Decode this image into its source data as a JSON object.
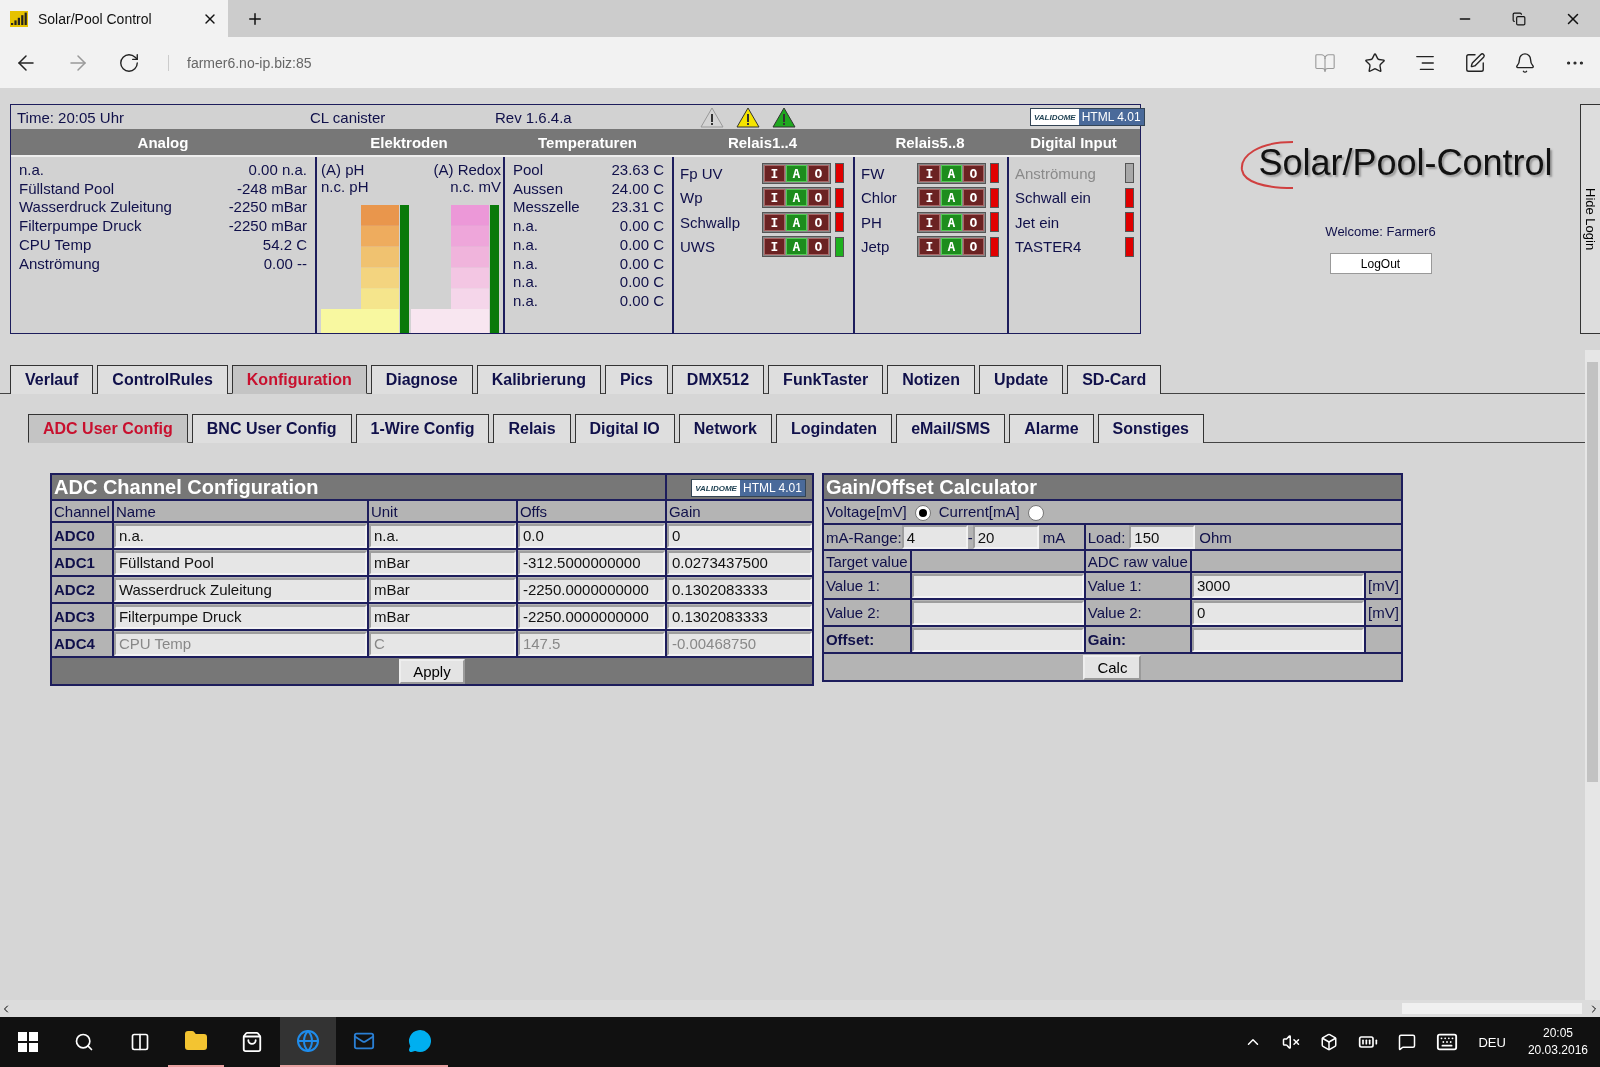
{
  "browser": {
    "tab_title": "Solar/Pool Control",
    "address": "farmer6.no-ip.biz:85"
  },
  "status": {
    "time": "Time: 20:05 Uhr",
    "mode": "CL canister",
    "revision": "Rev 1.6.4.a",
    "warnings": [
      {
        "color": "#d4d4d4"
      },
      {
        "color": "#f5e400"
      },
      {
        "color": "#1fa81f"
      }
    ],
    "badge": {
      "logo": "VALIDOME",
      "label": "HTML 4.01"
    }
  },
  "sections": [
    "Analog",
    "Elektroden",
    "Temperaturen",
    "Relais1..4",
    "Relais5..8",
    "Digital Input"
  ],
  "analog": [
    {
      "name": "n.a.",
      "value": "0.00 n.a."
    },
    {
      "name": "Füllstand Pool",
      "value": "-248 mBar"
    },
    {
      "name": "Wasserdruck Zuleitung",
      "value": "-2250 mBar"
    },
    {
      "name": "Filterpumpe Druck",
      "value": "-2250 mBar"
    },
    {
      "name": "CPU Temp",
      "value": "54.2 C"
    },
    {
      "name": "Anströmung",
      "value": "0.00 --"
    }
  ],
  "electrodes": [
    {
      "kind": "ph",
      "label": "(A) pH",
      "reading": "n.c. pH"
    },
    {
      "kind": "redox",
      "label": "(A) Redox",
      "reading": "n.c. mV"
    }
  ],
  "temperatures": [
    {
      "name": "Pool",
      "value": "23.63 C"
    },
    {
      "name": "Aussen",
      "value": "24.00 C"
    },
    {
      "name": "Messzelle",
      "value": "23.31 C"
    },
    {
      "name": "n.a.",
      "value": "0.00 C"
    },
    {
      "name": "n.a.",
      "value": "0.00 C"
    },
    {
      "name": "n.a.",
      "value": "0.00 C"
    },
    {
      "name": "n.a.",
      "value": "0.00 C"
    },
    {
      "name": "n.a.",
      "value": "0.00 C"
    }
  ],
  "relays_1_4": [
    {
      "name": "Fp UV",
      "on": false,
      "buttons": [
        {
          "label": "I",
          "selected": false
        },
        {
          "label": "A",
          "selected": true
        },
        {
          "label": "O",
          "selected": false
        }
      ]
    },
    {
      "name": "Wp",
      "on": false,
      "buttons": [
        {
          "label": "I",
          "selected": false
        },
        {
          "label": "A",
          "selected": true
        },
        {
          "label": "O",
          "selected": false
        }
      ]
    },
    {
      "name": "Schwallp",
      "on": false,
      "buttons": [
        {
          "label": "I",
          "selected": false
        },
        {
          "label": "A",
          "selected": true
        },
        {
          "label": "O",
          "selected": false
        }
      ]
    },
    {
      "name": "UWS",
      "on": true,
      "buttons": [
        {
          "label": "I",
          "selected": false
        },
        {
          "label": "A",
          "selected": true
        },
        {
          "label": "O",
          "selected": false
        }
      ]
    }
  ],
  "relays_5_8": [
    {
      "name": "FW",
      "on": false,
      "buttons": [
        {
          "label": "I",
          "selected": false
        },
        {
          "label": "A",
          "selected": true
        },
        {
          "label": "O",
          "selected": false
        }
      ]
    },
    {
      "name": "Chlor",
      "on": false,
      "buttons": [
        {
          "label": "I",
          "selected": false
        },
        {
          "label": "A",
          "selected": true
        },
        {
          "label": "O",
          "selected": false
        }
      ]
    },
    {
      "name": "PH",
      "on": false,
      "buttons": [
        {
          "label": "I",
          "selected": false
        },
        {
          "label": "A",
          "selected": true
        },
        {
          "label": "O",
          "selected": false
        }
      ]
    },
    {
      "name": "Jetp",
      "on": false,
      "buttons": [
        {
          "label": "I",
          "selected": false
        },
        {
          "label": "A",
          "selected": true
        },
        {
          "label": "O",
          "selected": false
        }
      ]
    }
  ],
  "digital_inputs": [
    {
      "name": "Anströmung",
      "disabled": true
    },
    {
      "name": "Schwall ein",
      "disabled": false
    },
    {
      "name": "Jet ein",
      "disabled": false
    },
    {
      "name": "TASTER4",
      "disabled": false
    }
  ],
  "login": {
    "logo": "Solar/Pool-Control",
    "welcome": "Welcome: Farmer6",
    "logout": "LogOut",
    "hide": "Hide Login"
  },
  "tabs": [
    {
      "label": "Verlauf",
      "selected": false
    },
    {
      "label": "ControlRules",
      "selected": false
    },
    {
      "label": "Konfiguration",
      "selected": true
    },
    {
      "label": "Diagnose",
      "selected": false
    },
    {
      "label": "Kalibrierung",
      "selected": false
    },
    {
      "label": "Pics",
      "selected": false
    },
    {
      "label": "DMX512",
      "selected": false
    },
    {
      "label": "FunkTaster",
      "selected": false
    },
    {
      "label": "Notizen",
      "selected": false
    },
    {
      "label": "Update",
      "selected": false
    },
    {
      "label": "SD-Card",
      "selected": false
    }
  ],
  "subtabs": [
    {
      "label": "ADC User Config",
      "selected": true
    },
    {
      "label": "BNC User Config",
      "selected": false
    },
    {
      "label": "1-Wire Config",
      "selected": false
    },
    {
      "label": "Relais",
      "selected": false
    },
    {
      "label": "Digital IO",
      "selected": false
    },
    {
      "label": "Network",
      "selected": false
    },
    {
      "label": "Logindaten",
      "selected": false
    },
    {
      "label": "eMail/SMS",
      "selected": false
    },
    {
      "label": "Alarme",
      "selected": false
    },
    {
      "label": "Sonstiges",
      "selected": false
    }
  ],
  "adc": {
    "title": "ADC Channel Configuration",
    "badge": {
      "logo": "VALIDOME",
      "label": "HTML 4.01"
    },
    "columns": [
      "Channel",
      "Name",
      "Unit",
      "Offs",
      "Gain"
    ],
    "rows": [
      {
        "channel": "ADC0",
        "name": "n.a.",
        "unit": "n.a.",
        "offs": "0.0",
        "gain": "0",
        "disabled": false
      },
      {
        "channel": "ADC1",
        "name": "Füllstand Pool",
        "unit": "mBar",
        "offs": "-312.5000000000",
        "gain": "0.0273437500",
        "disabled": false
      },
      {
        "channel": "ADC2",
        "name": "Wasserdruck Zuleitung",
        "unit": "mBar",
        "offs": "-2250.0000000000",
        "gain": "0.1302083333",
        "disabled": false
      },
      {
        "channel": "ADC3",
        "name": "Filterpumpe Druck",
        "unit": "mBar",
        "offs": "-2250.0000000000",
        "gain": "0.1302083333",
        "disabled": false
      },
      {
        "channel": "ADC4",
        "name": "CPU Temp",
        "unit": "C",
        "offs": "147.5",
        "gain": "-0.00468750",
        "disabled": true
      }
    ],
    "apply": "Apply"
  },
  "calculator": {
    "title": "Gain/Offset Calculator",
    "modes": [
      {
        "label": "Voltage[mV]",
        "selected": true
      },
      {
        "label": "Current[mA]",
        "selected": false
      }
    ],
    "range": {
      "label": "mA-Range:",
      "from": "4",
      "separator": "-",
      "to": "20",
      "unit": "mA"
    },
    "load": {
      "label": "Load:",
      "value": "150",
      "unit": "Ohm"
    },
    "target_header": "Target value",
    "raw_header": "ADC raw value",
    "rows": [
      {
        "target_label": "Value 1:",
        "raw_label": "Value 1:",
        "raw_value": "3000",
        "raw_unit": "[mV]"
      },
      {
        "target_label": "Value 2:",
        "raw_label": "Value 2:",
        "raw_value": "0",
        "raw_unit": "[mV]"
      }
    ],
    "offset_label": "Offset:",
    "gain_label": "Gain:",
    "button": "Calc"
  },
  "taskbar": {
    "language": "DEU",
    "time": "20:05",
    "date": "20.03.2016"
  }
}
